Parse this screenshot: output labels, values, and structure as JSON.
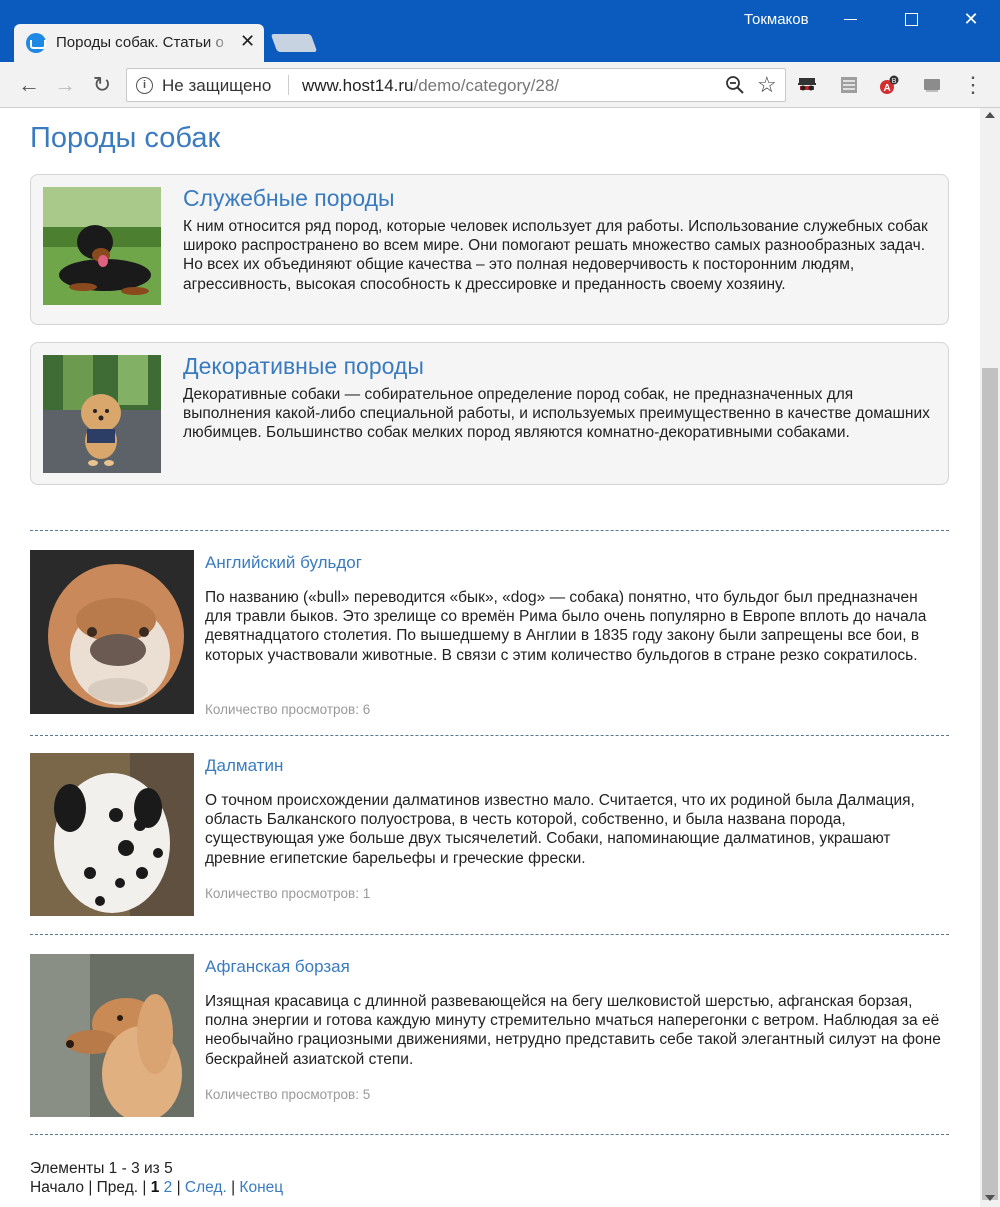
{
  "window": {
    "user": "Токмаков",
    "tab_title": "Породы собак. Статьи о",
    "tab_close": "✕",
    "minimize": "",
    "maximize": "",
    "close": "✕"
  },
  "toolbar": {
    "back": "←",
    "forward": "→",
    "reload": "↻",
    "security_text": "Не защищено",
    "url_host": "www.host14.ru",
    "url_path": "/demo/category/28/",
    "star": "☆",
    "menu": "⋮",
    "icons": [
      "info-icon",
      "zoom-out-icon",
      "star-icon",
      "incognito-extension-icon",
      "reader-extension-icon",
      "adblock-extension-icon",
      "cast-extension-icon",
      "menu-icon"
    ]
  },
  "page": {
    "title": "Породы собак",
    "categories": [
      {
        "title": "Служебные породы",
        "text": "К ним относится ряд пород, которые человек использует для работы. Использование служебных собак широко распространено во всем мире. Они помогают решать множество самых разнообразных задач. Но всех их объединяют общие качества – это полная недоверчивость к посторонним людям, агрессивность, высокая способность к дрессировке и преданность своему хозяину."
      },
      {
        "title": "Декоративные породы",
        "text": "Декоративные собаки — собирательное определение пород собак, не предназначенных для выполнения какой-либо специальной работы, и используемых преимущественно в качестве домашних любимцев. Большинство собак мелких пород являются комнатно-декоративными собаками."
      }
    ],
    "articles": [
      {
        "title": "Английский бульдог",
        "text": "По названию («bull» переводится «бык», «dog» — собака) понятно, что бульдог был предназначен для травли быков. Это зрелище со времён Рима было очень популярно в Европе вплоть до начала девятнадцатого столетия. По вышедшему в Англии в 1835 году закону были запрещены все бои, в которых участвовали животные. В связи с этим количество бульдогов в стране резко сократилось.",
        "views": "Количество просмотров: 6"
      },
      {
        "title": "Далматин",
        "text": "О точном происхождении далматинов известно мало. Считается, что их родиной была Далмация, область Балканского полуострова, в честь которой, собственно, и была названа порода, существующая уже больше двух тысячелетий. Собаки, напоминающие далматинов, украшают древние египетские барельефы и греческие фрески.",
        "views": "Количество просмотров: 1"
      },
      {
        "title": "Афганская борзая",
        "text": "Изящная красавица с длинной развевающейся на бегу шелковистой шерстью, афганская борзая, полна энергии и готова каждую минуту стремительно мчаться наперегонки с ветром. Наблюдая за её необычайно грациозными движениями, нетрудно представить себе такой элегантный силуэт на фоне бескрайней азиатской степи.",
        "views": "Количество просмотров: 5"
      }
    ],
    "pagination": {
      "info": "Элементы 1 - 3 из 5",
      "first": "Начало",
      "prev": "Пред.",
      "current": "1",
      "page2": "2",
      "next": "След.",
      "last": "Конец",
      "sep": " | "
    }
  },
  "colors": {
    "titlebar": "#0a5bbd",
    "link": "#3a7bbf",
    "muted": "#999999",
    "box_bg": "#f5f5f5"
  }
}
